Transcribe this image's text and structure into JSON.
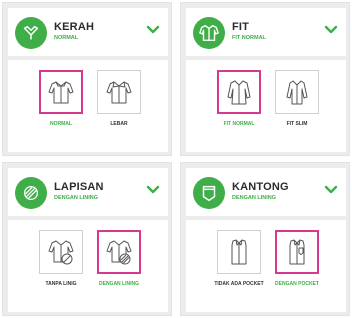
{
  "colors": {
    "accent": "#3fae49",
    "selected_border": "#d63a8e",
    "card_bg": "#ececec"
  },
  "cards": [
    {
      "title": "KERAH",
      "subtitle": "NORMAL",
      "icon": "collar-icon",
      "options": [
        {
          "label": "NORMAL",
          "icon": "shirt-icon",
          "selected": true
        },
        {
          "label": "LEBAR",
          "icon": "shirt-wide-collar-icon",
          "selected": false
        }
      ]
    },
    {
      "title": "FIT",
      "subtitle": "FIT NORMAL",
      "icon": "shirt-fit-icon",
      "options": [
        {
          "label": "FIT NORMAL",
          "icon": "shirt-fit-normal-icon",
          "selected": true
        },
        {
          "label": "FIT SLIM",
          "icon": "shirt-fit-slim-icon",
          "selected": false
        }
      ]
    },
    {
      "title": "LAPISAN",
      "subtitle": "DENGAN LINING",
      "icon": "lining-icon",
      "options": [
        {
          "label": "TANPA LINIG",
          "icon": "shirt-no-lining-icon",
          "selected": false
        },
        {
          "label": "DENGAN LINING",
          "icon": "shirt-with-lining-icon",
          "selected": true
        }
      ]
    },
    {
      "title": "KANTONG",
      "subtitle": "DENGAN LINING",
      "icon": "pocket-icon",
      "options": [
        {
          "label": "TIDAK ADA POCKET",
          "icon": "shirt-no-pocket-icon",
          "selected": false
        },
        {
          "label": "DENGAN POCKET",
          "icon": "shirt-with-pocket-icon",
          "selected": true
        }
      ]
    }
  ]
}
